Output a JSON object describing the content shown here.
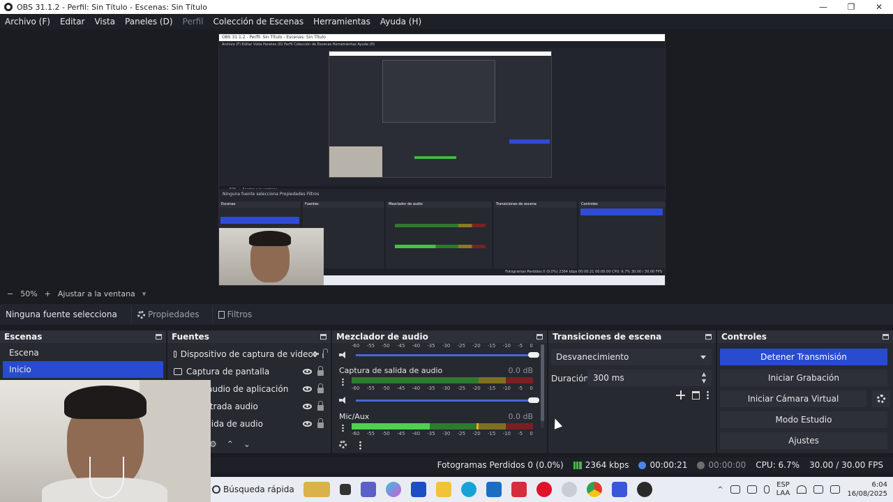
{
  "window": {
    "title": "OBS 31.1.2 - Perfil: Sin Título - Escenas: Sin Título",
    "min_glyph": "—",
    "max_glyph": "❐",
    "close_glyph": "✕"
  },
  "menubar": {
    "items": [
      "Archivo (F)",
      "Editar",
      "Vista",
      "Paneles (D)",
      "Perfil",
      "Colección de Escenas",
      "Herramientas",
      "Ayuda (H)"
    ]
  },
  "preview": {
    "nested_title": "OBS 31.1.2 - Perfil: Sin Título - Escenas: Sin Título",
    "nested_menu": "Archivo (F)   Editar   Vista   Paneles (D)   Perfil   Colección de Escenas   Herramientas   Ayuda (H)",
    "nested_zoom": "—  50%  +  Ajustar a la ventana",
    "nested_source": "Ninguna fuente selecciona      Propiedades      Filtros",
    "nested_status": "Fotogramas Perdidos 0 (0.0%)   2364 kbps   00:00:21   00:00:00   CPU: 6.7%   30.00 / 30.00 FPS",
    "nested_heads": [
      "Escenas",
      "Fuentes",
      "Mezclador de audio",
      "Transiciones de escena",
      "Controles"
    ]
  },
  "zoombar": {
    "minus": "−",
    "zoom": "50%",
    "plus": "+",
    "fit": "Ajustar a la ventana",
    "chevron": "▾"
  },
  "source_toolbar": {
    "no_source": "Ninguna fuente selecciona",
    "properties": "Propiedades",
    "filters": "Filtros"
  },
  "scenes": {
    "title": "Escenas",
    "items": [
      {
        "label": "Escena",
        "selected": false
      },
      {
        "label": "Inicio",
        "selected": true
      }
    ]
  },
  "sources": {
    "title": "Fuentes",
    "items": [
      {
        "label": "Dispositivo de captura de video"
      },
      {
        "label": "Captura de pantalla"
      },
      {
        "label": "a de audio de aplicación"
      },
      {
        "label": "de entrada audio"
      },
      {
        "label": "de salida de audio"
      }
    ],
    "footer_icons": [
      "gear-icon",
      "up-icon",
      "down-icon"
    ]
  },
  "mixer": {
    "title": "Mezclador de audio",
    "scale": [
      "-60",
      "-55",
      "-50",
      "-45",
      "-40",
      "-35",
      "-30",
      "-25",
      "-20",
      "-15",
      "-10",
      "-5",
      "0"
    ],
    "tracks": [
      {
        "name": "Captura de salida de audio",
        "db": "0.0 dB",
        "level": 0.0
      },
      {
        "name": "Mic/Aux",
        "db": "0.0 dB",
        "level": 0.43,
        "peak": 0.69
      }
    ]
  },
  "transitions": {
    "title": "Transiciones de escena",
    "selected": "Desvanecimiento",
    "duration_label": "Duración",
    "duration_value": "300 ms"
  },
  "controls": {
    "title": "Controles",
    "buttons": [
      "Detener Transmisión",
      "Iniciar Grabación",
      "Iniciar Cámara Virtual",
      "Modo Estudio",
      "Ajustes"
    ]
  },
  "statusbar": {
    "dropped": "Fotogramas Perdidos 0 (0.0%)",
    "bitrate": "2364 kbps",
    "stream_time": "00:00:21",
    "rec_time": "00:00:00",
    "cpu": "CPU: 6.7%",
    "fps": "30.00 / 30.00 FPS"
  },
  "taskbar": {
    "search": "Búsqueda rápida",
    "lang1": "ESP",
    "lang2": "LAA",
    "time": "6:04",
    "date": "16/08/2025",
    "caret": "^"
  },
  "colors": {
    "accent": "#284bd0",
    "panel": "#262930",
    "background": "#1a1c22"
  }
}
